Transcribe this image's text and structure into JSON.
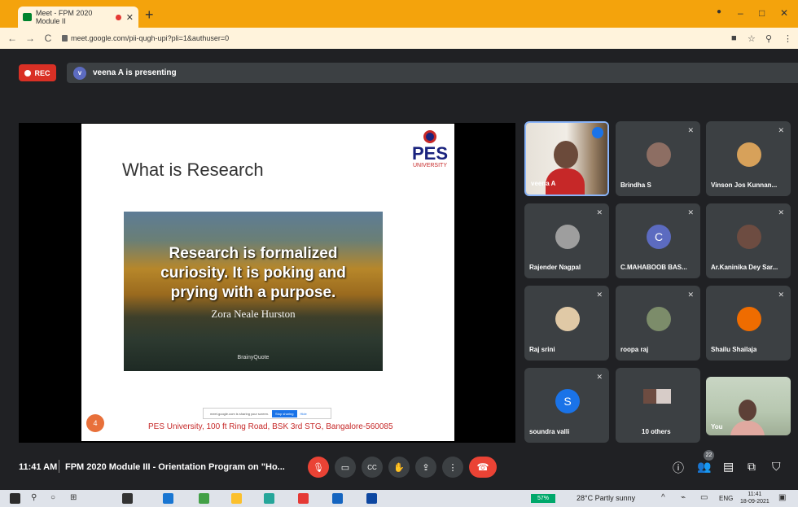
{
  "browser": {
    "tab_title": "Meet - FPM 2020 Module II",
    "tab_close": "✕",
    "new_tab": "+",
    "url": "meet.google.com/pii-qugh-upi?pli=1&authuser=0",
    "window_controls": {
      "minimize": "–",
      "maximize": "□",
      "close": "✕"
    }
  },
  "meet": {
    "rec_label": "REC",
    "presenter_initial": "v",
    "presenting_text": "veena A is presenting"
  },
  "slide": {
    "title": "What is Research",
    "logo_text": "PES",
    "logo_sub": "UNIVERSITY",
    "quote_lines": [
      "Research is formalized",
      "curiosity. It is poking and",
      "prying with a purpose."
    ],
    "quote_author": "Zora Neale Hurston",
    "quote_brand": "BrainyQuote",
    "share_text": "meet.google.com is sharing your screen.",
    "stop_sharing": "Stop sharing",
    "hide": "Hide",
    "page_number": "4",
    "footer": "PES University,  100 ft Ring Road, BSK 3rd STG, Bangalore-560085"
  },
  "participants": [
    {
      "name": "veena A",
      "type": "video",
      "active": true
    },
    {
      "name": "Brindha S",
      "type": "photo"
    },
    {
      "name": "Vinson Jos Kunnan...",
      "type": "photo"
    },
    {
      "name": "Rajender Nagpal",
      "type": "photo"
    },
    {
      "name": "C.MAHABOOB BAS...",
      "type": "letter",
      "letter": "C",
      "color": "#1a73e8"
    },
    {
      "name": "Ar.Kaninika Dey Sar...",
      "type": "photo"
    },
    {
      "name": "Raj srini",
      "type": "photo"
    },
    {
      "name": "roopa raj",
      "type": "photo"
    },
    {
      "name": "Shailu Shailaja",
      "type": "photo"
    },
    {
      "name": "soundra valli",
      "type": "letter",
      "letter": "S",
      "color": "#1a73e8"
    },
    {
      "name": "10 others",
      "type": "others"
    },
    {
      "name": "You",
      "type": "video"
    }
  ],
  "controls": {
    "time": "11:41 AM",
    "meeting_title": "FPM 2020 Module III - Orientation Program on \"Ho...",
    "people_count": "22",
    "mic_icon": "🎙",
    "camera_icon": "▭",
    "captions_icon": "CC",
    "hand_icon": "✋",
    "present_icon": "⇪",
    "more_icon": "⋮",
    "hangup_icon": "☎",
    "info_icon": "ⓘ",
    "people_icon": "👥",
    "chat_icon": "▤",
    "activities_icon": "⧉",
    "lock_icon": "⛉"
  },
  "taskbar": {
    "battery": "57%",
    "weather": "28°C  Partly sunny",
    "lang": "ENG",
    "clock_time": "11:41",
    "clock_date": "18-09-2021"
  },
  "colors": {
    "tab_bar": "#f4a30c",
    "meet_bg": "#202124",
    "tile_bg": "#3c4043",
    "hangup": "#ea4335",
    "accent": "#1a73e8"
  }
}
